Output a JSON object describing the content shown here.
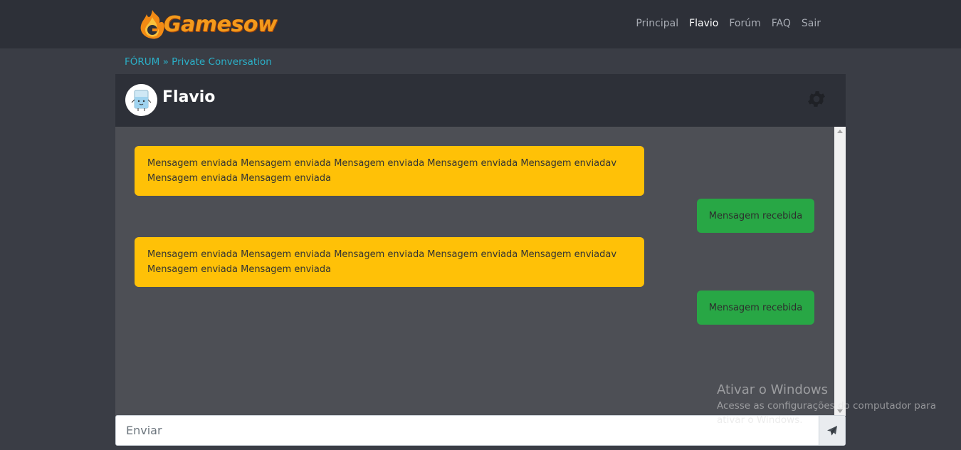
{
  "brand": {
    "name": "Gamesow"
  },
  "nav": {
    "items": [
      {
        "label": "Principal",
        "active": false
      },
      {
        "label": "Flavio",
        "active": true
      },
      {
        "label": "Forúm",
        "active": false
      },
      {
        "label": "FAQ",
        "active": false
      },
      {
        "label": "Sair",
        "active": false
      }
    ]
  },
  "breadcrumb": {
    "root": "FÓRUM",
    "separator": "»",
    "current": "Private Conversation"
  },
  "chat": {
    "title": "Flavio",
    "settings_icon": "gear-icon",
    "messages": [
      {
        "type": "sent",
        "text": "Mensagem enviada Mensagem enviada Mensagem enviada Mensagem enviada Mensagem enviadav Mensagem enviada Mensagem enviada"
      },
      {
        "type": "received",
        "text": "Mensagem recebida"
      },
      {
        "type": "sent",
        "text": "Mensagem enviada Mensagem enviada Mensagem enviada Mensagem enviada Mensagem enviadav Mensagem enviada Mensagem enviada"
      },
      {
        "type": "received",
        "text": "Mensagem recebida"
      }
    ],
    "input_placeholder": "Enviar",
    "send_icon": "paper-plane-icon"
  },
  "watermark": {
    "title": "Ativar o Windows",
    "subtitle": "Acesse as configurações do computador para ativar o Windows."
  },
  "colors": {
    "sent_bubble": "#ffc107",
    "received_bubble": "#28a745",
    "accent_link": "#2bb0c8",
    "header_bg": "#2d3038"
  }
}
